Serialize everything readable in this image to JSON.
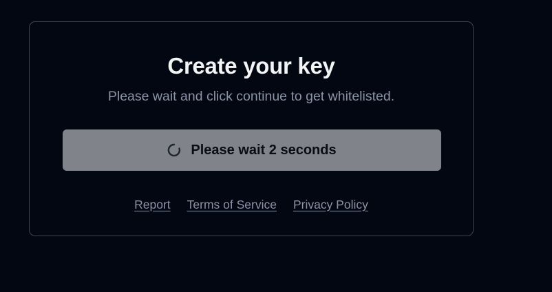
{
  "card": {
    "title": "Create your key",
    "subtitle": "Please wait and click continue to get whitelisted."
  },
  "button": {
    "label": "Please wait 2 seconds",
    "icon": "spinner-icon",
    "state": "disabled"
  },
  "footer": {
    "links": [
      {
        "label": "Report"
      },
      {
        "label": "Terms of Service"
      },
      {
        "label": "Privacy Policy"
      }
    ]
  },
  "colors": {
    "background": "#030712",
    "card_border": "#3f4451",
    "title": "#f3f4f6",
    "muted_text": "#8b93a7",
    "button_bg": "#808389",
    "button_text": "#0b0d12"
  }
}
